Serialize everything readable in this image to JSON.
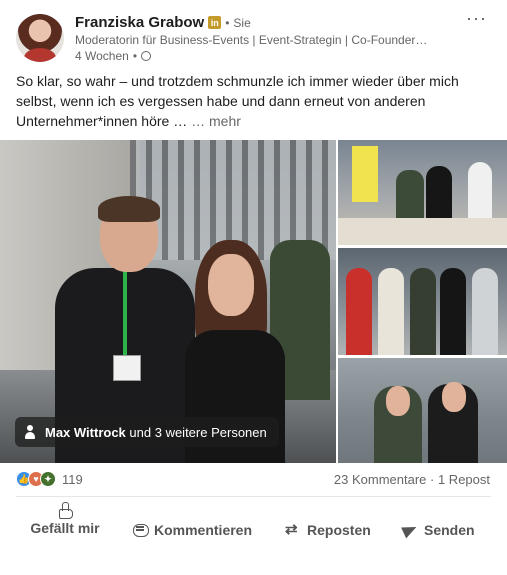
{
  "author": {
    "name": "Franziska Grabow",
    "badge": "in",
    "connection": "Sie",
    "headline": "Moderatorin für Business-Events | Event-Strategin | Co-Founder…",
    "time": "4 Wochen",
    "visibility_icon": "globe-icon"
  },
  "post": {
    "text": "So klar, so wahr – und trotzdem schmunzle ich immer wieder über mich selbst, wenn ich es vergessen habe und dann erneut von anderen Unternehmer*innen höre …",
    "see_more": "… mehr"
  },
  "media": {
    "tag_name": "Max Wittrock",
    "tag_rest": "und 3 weitere Personen"
  },
  "social": {
    "reaction_count": "119",
    "comments_reposts": "23 Kommentare · 1 Repost",
    "reaction_icons": [
      "like-icon",
      "love-icon",
      "insightful-icon"
    ]
  },
  "actions": {
    "like": "Gefällt mir",
    "comment": "Kommentieren",
    "repost": "Reposten",
    "send": "Senden"
  },
  "colors": {
    "like": "#378fe9",
    "love": "#df704d",
    "insight": "#44712e",
    "lanyard": "#2db34a"
  }
}
